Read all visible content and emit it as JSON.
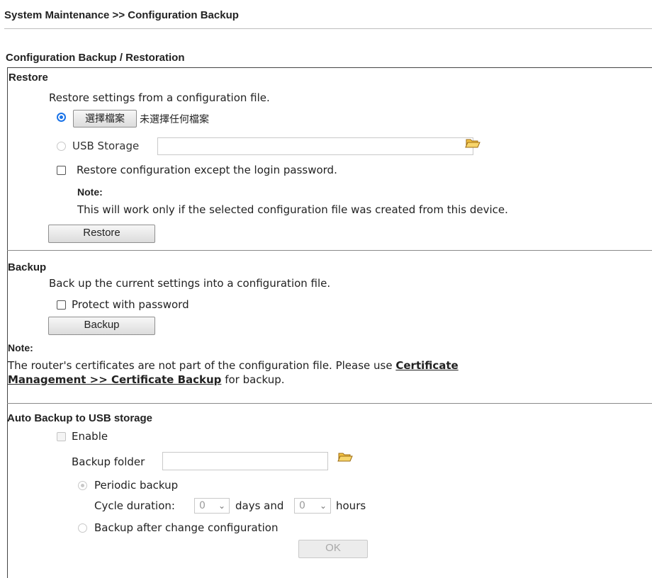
{
  "page": {
    "breadcrumb": "System Maintenance >> Configuration Backup"
  },
  "box": {
    "title": "Configuration Backup / Restoration"
  },
  "restore": {
    "heading": "Restore",
    "description": "Restore settings from a configuration file.",
    "choose_file_label": "選擇檔案",
    "no_file_text": "未選擇任何檔案",
    "usb_label": "USB Storage",
    "usb_value": "",
    "except_password_label": "Restore configuration except the login password.",
    "note_label": "Note:",
    "note_text": "This will work only if the selected configuration file was created from this device.",
    "button_label": "Restore"
  },
  "backup": {
    "heading": "Backup",
    "description": "Back up the current settings into a configuration file.",
    "protect_label": "Protect with password",
    "button_label": "Backup",
    "note_label": "Note:",
    "note_text_1": "The router's certificates are not part of the configuration file. Please use ",
    "note_link_1": "Certificate",
    "note_link_2": "Management >> Certificate Backup",
    "note_text_2": " for backup."
  },
  "auto_backup": {
    "heading": "Auto Backup to USB storage",
    "enable_label": "Enable",
    "folder_label": "Backup folder",
    "folder_value": "",
    "periodic_label": "Periodic backup",
    "cycle_label": "Cycle duration:",
    "days_value": "0",
    "days_label": "days and",
    "hours_value": "0",
    "hours_label": "hours",
    "after_change_label": "Backup after change configuration",
    "ok_label": "OK"
  },
  "icons": {
    "folder": "folder-open-icon",
    "chevron": "chevron-down-icon"
  },
  "colors": {
    "radio_selected": "#1a73e8",
    "folder_icon": "#e8a317"
  }
}
